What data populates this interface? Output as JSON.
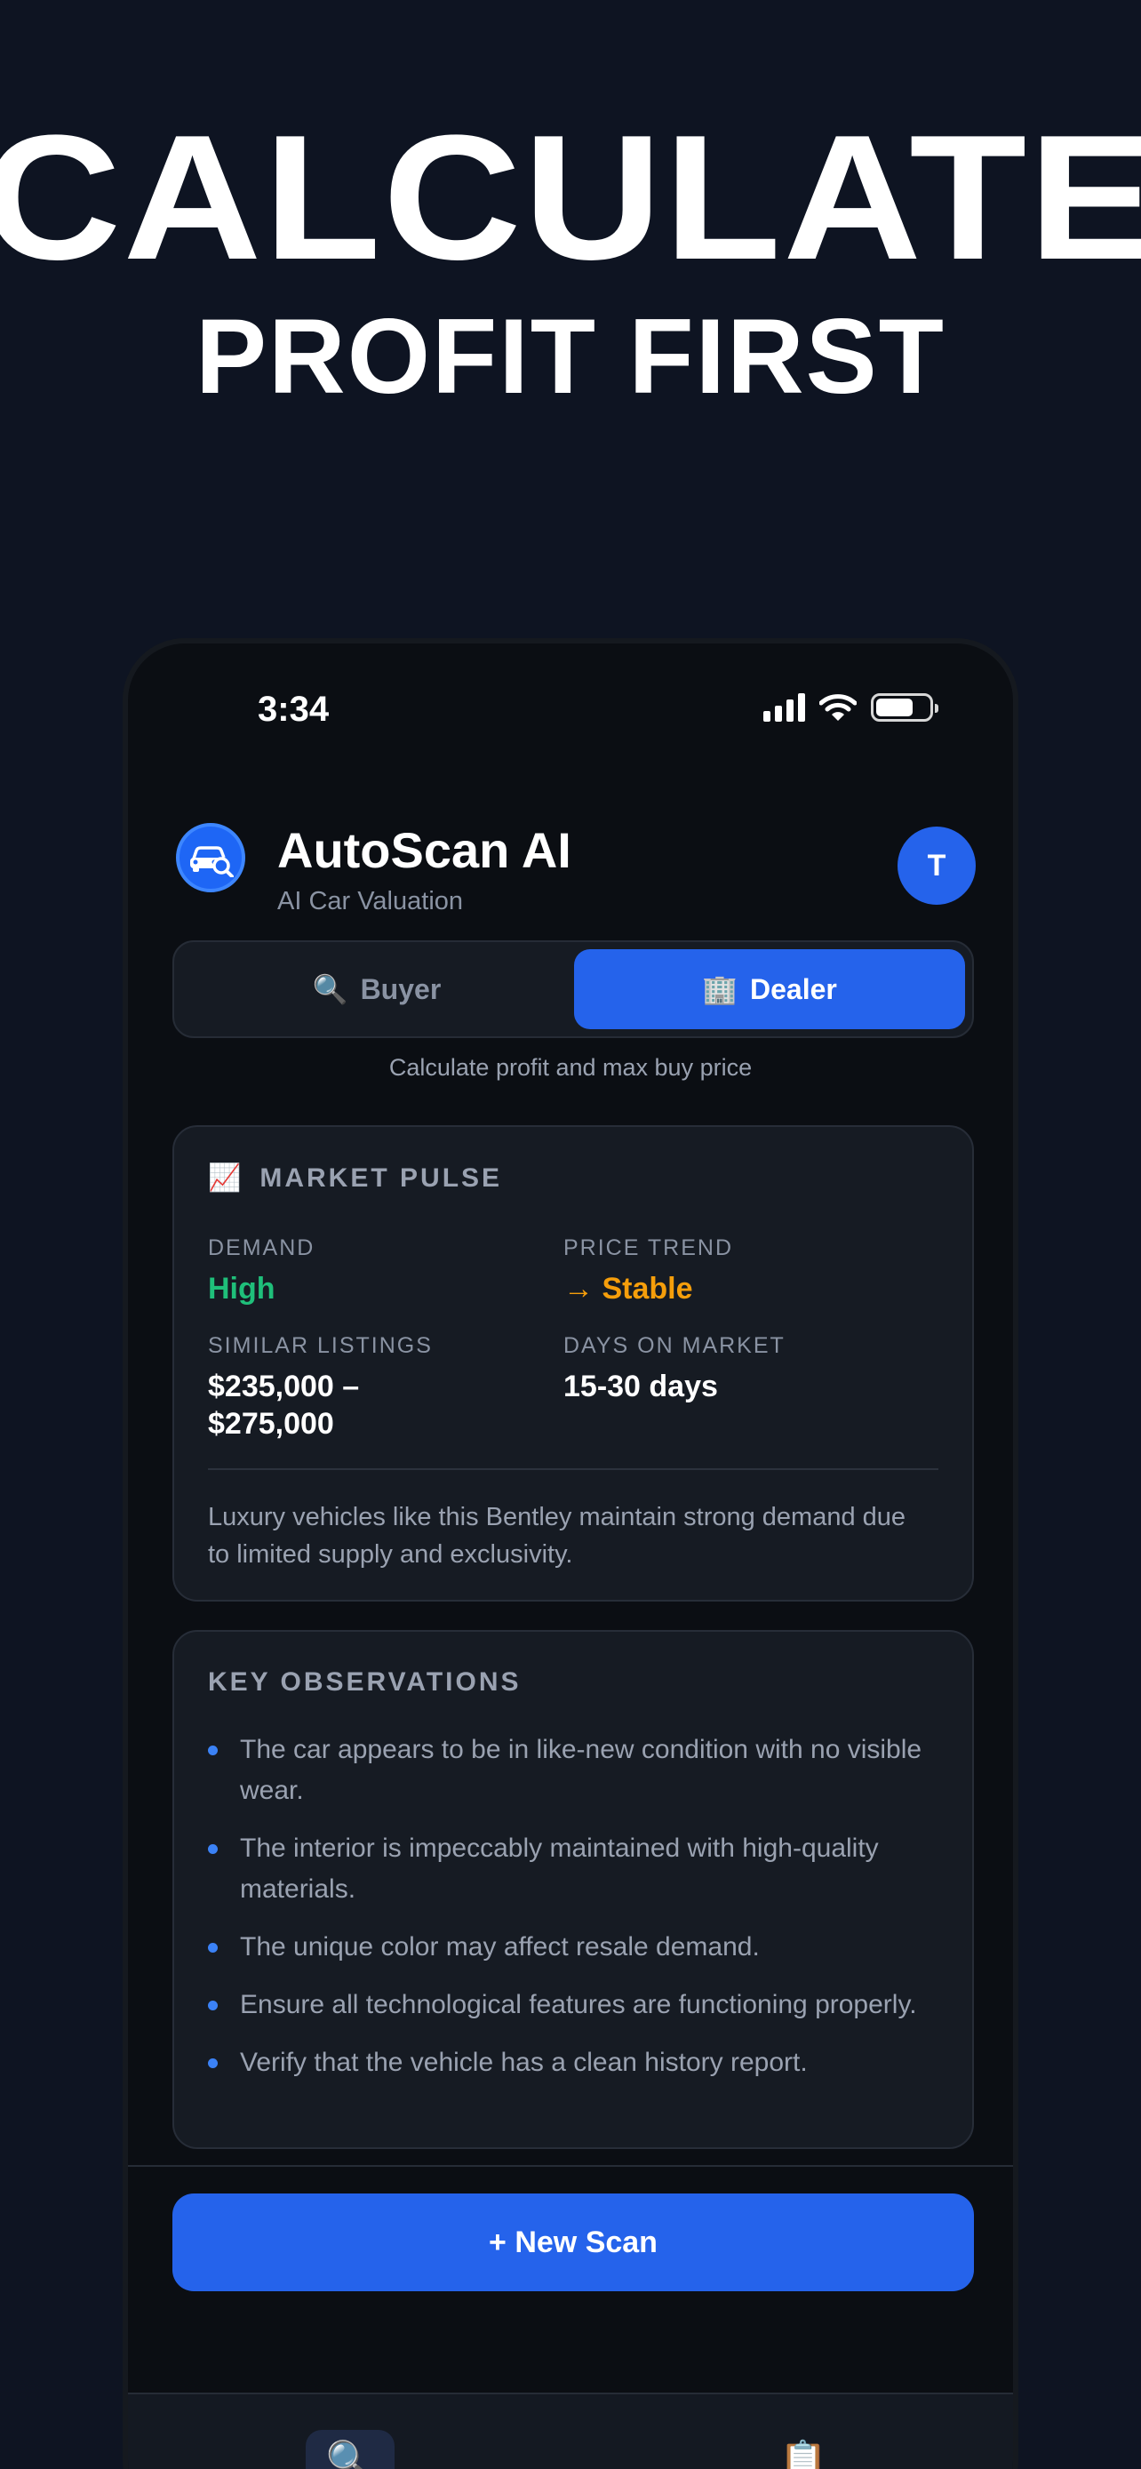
{
  "promo": {
    "line1": "CALCULATE",
    "line2": "PROFIT FIRST"
  },
  "status_bar": {
    "time": "3:34"
  },
  "header": {
    "title": "AutoScan AI",
    "subtitle": "AI Car Valuation",
    "avatar_initial": "T"
  },
  "mode_toggle": {
    "buyer": {
      "icon": "🔍",
      "label": "Buyer"
    },
    "dealer": {
      "icon": "🏢",
      "label": "Dealer"
    },
    "selected": "Dealer",
    "caption": "Calculate profit and max buy price"
  },
  "market_pulse": {
    "icon": "📈",
    "title": "MARKET PULSE",
    "demand": {
      "label": "DEMAND",
      "value": "High"
    },
    "price_trend": {
      "label": "PRICE TREND",
      "value": "→ Stable"
    },
    "similar_listings": {
      "label": "SIMILAR LISTINGS",
      "value": "$235,000 – $275,000"
    },
    "days_on_market": {
      "label": "DAYS ON MARKET",
      "value": "15-30 days"
    },
    "note": "Luxury vehicles like this Bentley maintain strong demand due to limited supply and exclusivity."
  },
  "key_observations": {
    "title": "KEY OBSERVATIONS",
    "items": [
      "The car appears to be in like-new condition with no visible wear.",
      "The interior is impeccably maintained with high-quality materials.",
      "The unique color may affect resale demand.",
      "Ensure all technological features are functioning properly.",
      "Verify that the vehicle has a clean history report."
    ]
  },
  "actions": {
    "new_scan": "+ New Scan"
  },
  "tab_bar": {
    "scan_icon": "🔍",
    "history_icon": "📋"
  },
  "colors": {
    "accent": "#2563eb",
    "demand_high": "#1fbf7a",
    "trend_stable": "#f59e0b",
    "background": "#0e1422"
  }
}
